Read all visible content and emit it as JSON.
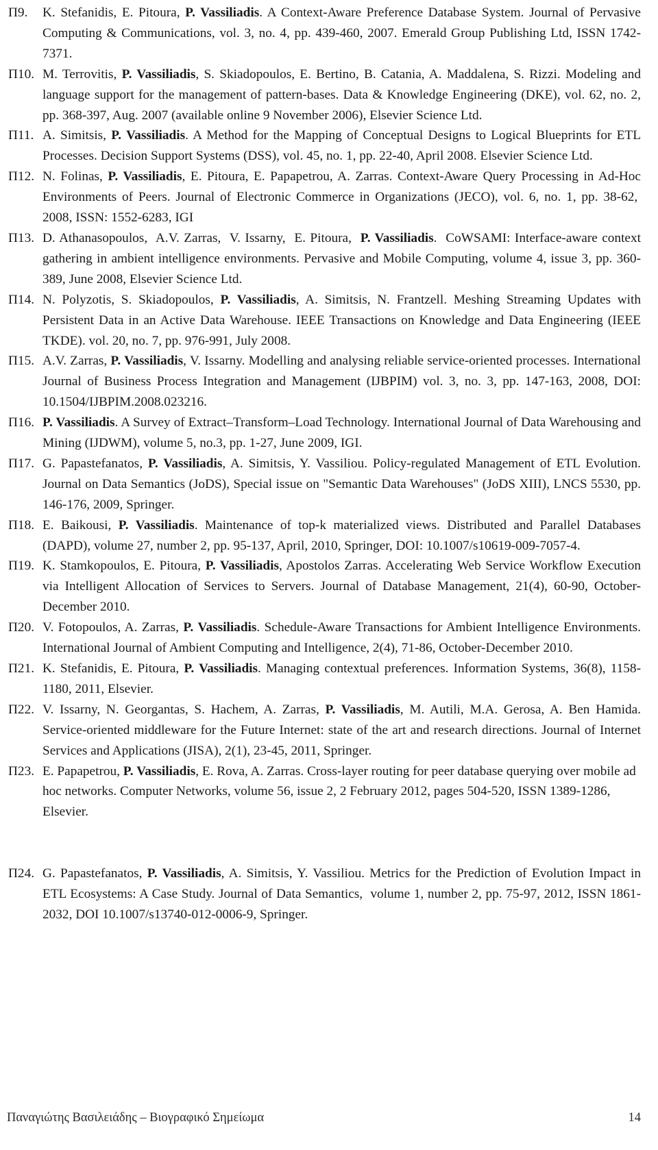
{
  "document": {
    "type": "curriculum-vitae-publication-list",
    "page_number": "14",
    "footer_title": "Παναγιώτης Βασιλειάδης – Βιογραφικό Σημείωμα",
    "highlighted_author": "P. Vassiliadis"
  },
  "references": [
    {
      "label": "Π9.",
      "text": "K. Stefanidis, E. Pitoura, P. Vassiliadis. A Context-Aware Preference Database System. Journal of Pervasive Computing & Communications, vol. 3, no. 4, pp. 439-460, 2007. Emerald Group Publishing Ltd, ISSN 1742-7371.",
      "authors": "K. Stefanidis, E. Pitoura, P. Vassiliadis",
      "title": "A Context-Aware Preference Database System",
      "venue": "Journal of Pervasive Computing & Communications",
      "volume": "3",
      "number": "4",
      "pages": "439-460",
      "year": "2007",
      "publisher": "Emerald Group Publishing Ltd",
      "issn": "1742-7371"
    },
    {
      "label": "Π10.",
      "text": "M. Terrovitis, P. Vassiliadis, S. Skiadopoulos, E. Bertino, B. Catania, A. Maddalena, S. Rizzi. Modeling and language support for the management of pattern-bases. Data & Knowledge Engineering (DKE), vol. 62, no. 2, pp. 368-397, Aug. 2007 (available online 9 November 2006), Elsevier Science Ltd.",
      "authors": "M. Terrovitis, P. Vassiliadis, S. Skiadopoulos, E. Bertino, B. Catania, A. Maddalena, S. Rizzi",
      "title": "Modeling and language support for the management of pattern-bases",
      "venue": "Data & Knowledge Engineering (DKE)",
      "volume": "62",
      "number": "2",
      "pages": "368-397",
      "year": "Aug. 2007",
      "publisher": "Elsevier Science Ltd"
    },
    {
      "label": "Π11.",
      "text": "A. Simitsis, P. Vassiliadis. A Method for the Mapping of Conceptual Designs to Logical Blueprints for ETL Processes. Decision Support Systems (DSS), vol. 45, no. 1, pp. 22-40, April 2008. Elsevier Science Ltd.",
      "authors": "A. Simitsis, P. Vassiliadis",
      "title": "A Method for the Mapping of Conceptual Designs to Logical Blueprints for ETL Processes",
      "venue": "Decision Support Systems (DSS)",
      "volume": "45",
      "number": "1",
      "pages": "22-40",
      "year": "April 2008",
      "publisher": "Elsevier Science Ltd"
    },
    {
      "label": "Π12.",
      "text": "N. Folinas, P. Vassiliadis, E. Pitoura, E. Papapetrou, A. Zarras. Context-Aware Query Processing in Ad-Hoc Environments of Peers. Journal of Electronic Commerce in Organizations (JECO), vol. 6, no. 1, pp. 38-62,  2008, ISSN: 1552-6283, IGI",
      "authors": "N. Folinas, P. Vassiliadis, E. Pitoura, E. Papapetrou, A. Zarras",
      "title": "Context-Aware Query Processing in Ad-Hoc Environments of Peers",
      "venue": "Journal of Electronic Commerce in Organizations (JECO)",
      "volume": "6",
      "number": "1",
      "pages": "38-62",
      "year": "2008",
      "issn": "1552-6283",
      "publisher": "IGI"
    },
    {
      "label": "Π13.",
      "text": "D. Athanasopoulos,  A.V. Zarras,  V. Issarny,  E. Pitoura,  P. Vassiliadis.  CoWSAMI: Interface-aware context gathering in ambient intelligence environments. Pervasive and Mobile Computing, volume 4, issue 3, pp. 360-389, June 2008, Elsevier Science Ltd.",
      "authors": "D. Athanasopoulos, A.V. Zarras, V. Issarny, E. Pitoura, P. Vassiliadis",
      "title": "CoWSAMI: Interface-aware context gathering in ambient intelligence environments",
      "venue": "Pervasive and Mobile Computing",
      "volume": "4",
      "issue": "3",
      "pages": "360-389",
      "year": "June 2008",
      "publisher": "Elsevier Science Ltd"
    },
    {
      "label": "Π14.",
      "text": "N. Polyzotis, S. Skiadopoulos, P. Vassiliadis, A. Simitsis, N. Frantzell. Meshing Streaming Updates with Persistent Data in an Active Data Warehouse. IEEE Transactions on Knowledge and Data Engineering (IEEE TKDE). vol. 20, no. 7, pp. 976-991, July 2008.",
      "authors": "N. Polyzotis, S. Skiadopoulos, P. Vassiliadis, A. Simitsis, N. Frantzell",
      "title": "Meshing Streaming Updates with Persistent Data in an Active Data Warehouse",
      "venue": "IEEE Transactions on Knowledge and Data Engineering (IEEE TKDE)",
      "volume": "20",
      "number": "7",
      "pages": "976-991",
      "year": "July 2008"
    },
    {
      "label": "Π15.",
      "text": "A.V. Zarras, P. Vassiliadis, V. Issarny. Modelling and analysing reliable service-oriented processes. International Journal of Business Process Integration and Management (IJBPIM) vol. 3, no. 3, pp. 147-163, 2008, DOI: 10.1504/IJBPIM.2008.023216.",
      "authors": "A.V. Zarras, P. Vassiliadis, V. Issarny",
      "title": "Modelling and analysing reliable service-oriented processes",
      "venue": "International Journal of Business Process Integration and Management (IJBPIM)",
      "volume": "3",
      "number": "3",
      "pages": "147-163",
      "year": "2008",
      "doi": "10.1504/IJBPIM.2008.023216"
    },
    {
      "label": "Π16.",
      "text": "P. Vassiliadis. A Survey of Extract–Transform–Load Technology. International Journal of Data Warehousing and Mining (IJDWM), volume 5, no.3, pp. 1-27, June 2009, IGI.",
      "authors": "P. Vassiliadis",
      "title": "A Survey of Extract–Transform–Load Technology",
      "venue": "International Journal of Data Warehousing and Mining (IJDWM)",
      "volume": "5",
      "number": "3",
      "pages": "1-27",
      "year": "June 2009",
      "publisher": "IGI"
    },
    {
      "label": "Π17.",
      "text": "G. Papastefanatos, P. Vassiliadis, A. Simitsis, Y. Vassiliou. Policy-regulated Management of ETL Evolution. Journal on Data Semantics (JoDS), Special issue on \"Semantic Data Warehouses\" (JoDS XIII), LNCS 5530, pp. 146-176, 2009, Springer.",
      "authors": "G. Papastefanatos, P. Vassiliadis, A. Simitsis, Y. Vassiliou",
      "title": "Policy-regulated Management of ETL Evolution",
      "venue": "Journal on Data Semantics (JoDS)",
      "special_issue": "Semantic Data Warehouses (JoDS XIII)",
      "series": "LNCS 5530",
      "pages": "146-176",
      "year": "2009",
      "publisher": "Springer"
    },
    {
      "label": "Π18.",
      "text": "E. Baikousi, P. Vassiliadis. Maintenance of top-k materialized views. Distributed and Parallel Databases (DAPD), volume 27, number 2, pp. 95-137, April, 2010, Springer, DOI: 10.1007/s10619-009-7057-4.",
      "authors": "E. Baikousi, P. Vassiliadis",
      "title": "Maintenance of top-k materialized views",
      "venue": "Distributed and Parallel Databases (DAPD)",
      "volume": "27",
      "number": "2",
      "pages": "95-137",
      "year": "April, 2010",
      "publisher": "Springer",
      "doi": "10.1007/s10619-009-7057-4"
    },
    {
      "label": "Π19.",
      "text": "K. Stamkopoulos, E. Pitoura, P. Vassiliadis, Apostolos Zarras. Accelerating Web Service Workflow Execution via Intelligent Allocation of Services to Servers. Journal of Database Management, 21(4), 60-90, October-December 2010.",
      "authors": "K. Stamkopoulos, E. Pitoura, P. Vassiliadis, Apostolos Zarras",
      "title": "Accelerating Web Service Workflow Execution via Intelligent Allocation of Services to Servers",
      "venue": "Journal of Database Management",
      "volume": "21(4)",
      "pages": "60-90",
      "year": "October-December 2010"
    },
    {
      "label": "Π20.",
      "text": "V. Fotopoulos, A. Zarras, P. Vassiliadis. Schedule-Aware Transactions for Ambient Intelligence Environments. International Journal of Ambient Computing and Intelligence, 2(4), 71-86, October-December 2010.",
      "authors": "V. Fotopoulos, A. Zarras, P. Vassiliadis",
      "title": "Schedule-Aware Transactions for Ambient Intelligence Environments",
      "venue": "International Journal of Ambient Computing and Intelligence",
      "volume": "2(4)",
      "pages": "71-86",
      "year": "October-December 2010"
    },
    {
      "label": "Π21.",
      "text": "K. Stefanidis, E. Pitoura, P. Vassiliadis. Managing contextual preferences. Information Systems, 36(8), 1158-1180, 2011, Elsevier.",
      "authors": "K. Stefanidis, E. Pitoura, P. Vassiliadis",
      "title": "Managing contextual preferences",
      "venue": "Information Systems",
      "volume": "36(8)",
      "pages": "1158-1180",
      "year": "2011",
      "publisher": "Elsevier"
    },
    {
      "label": "Π22.",
      "text": "V. Issarny, N. Georgantas, S. Hachem, A. Zarras, P. Vassiliadis, M. Autili, M.A. Gerosa, A. Ben Hamida. Service-oriented middleware for the Future Internet: state of the art and research directions. Journal of Internet Services and Applications (JISA), 2(1), 23-45, 2011, Springer.",
      "authors": "V. Issarny, N. Georgantas, S. Hachem, A. Zarras, P. Vassiliadis, M. Autili, M.A. Gerosa, A. Ben Hamida",
      "title": "Service-oriented middleware for the Future Internet: state of the art and research directions",
      "venue": "Journal of Internet Services and Applications (JISA)",
      "volume": "2(1)",
      "pages": "23-45",
      "year": "2011",
      "publisher": "Springer"
    },
    {
      "label": "Π23.",
      "text": "E. Papapetrou, P. Vassiliadis, E. Rova, A. Zarras. Cross-layer routing for peer database querying over mobile ad hoc networks. Computer Networks, volume 56, issue 2, 2 February 2012, pages 504-520, ISSN 1389-1286, Elsevier.",
      "authors": "E. Papapetrou, P. Vassiliadis, E. Rova, A. Zarras",
      "title": "Cross-layer routing for peer database querying over mobile ad hoc networks",
      "venue": "Computer Networks",
      "volume": "56",
      "issue": "2",
      "pages": "504-520",
      "year": "2 February 2012",
      "issn": "1389-1286",
      "publisher": "Elsevier"
    },
    {
      "label": "Π24.",
      "text": "G. Papastefanatos, P. Vassiliadis, A. Simitsis, Y. Vassiliou. Metrics for the Prediction of Evolution Impact in ETL Ecosystems: A Case Study. Journal of Data Semantics,  volume 1, number 2, pp. 75-97, 2012, ISSN 1861-2032, DOI 10.1007/s13740-012-0006-9, Springer.",
      "authors": "G. Papastefanatos, P. Vassiliadis, A. Simitsis, Y. Vassiliou",
      "title": "Metrics for the Prediction of Evolution Impact in ETL Ecosystems: A Case Study",
      "venue": "Journal of Data Semantics",
      "volume": "1",
      "number": "2",
      "pages": "75-97",
      "year": "2012",
      "issn": "1861-2032",
      "doi": "10.1007/s13740-012-0006-9",
      "publisher": "Springer"
    }
  ]
}
